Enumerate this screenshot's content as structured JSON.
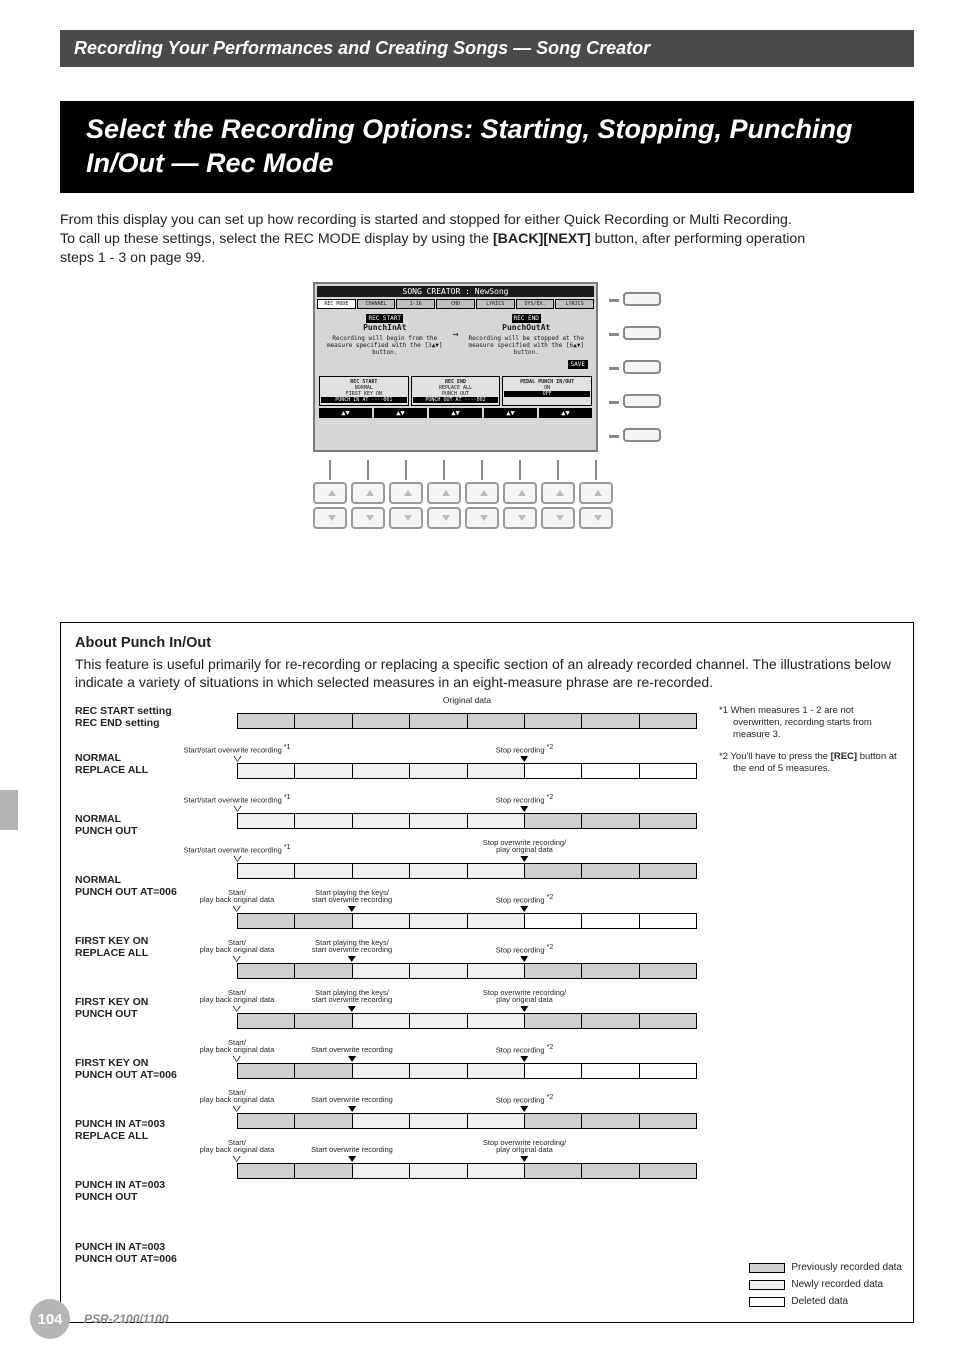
{
  "chapterHeader": "Recording Your Performances and Creating Songs — Song Creator",
  "sectionTitle": "Select the Recording Options: Starting, Stopping, Punching In/Out — Rec Mode",
  "intro": {
    "line1": "From this display you can set up how recording is started and stopped for either Quick Recording or Multi Recording.",
    "line2a": "To call up these settings, select the REC MODE display by using the ",
    "line2bold": "[BACK][NEXT]",
    "line2b": " button, after performing operation",
    "line3": "steps 1 - 3 on page 99."
  },
  "lcd": {
    "title": "SONG CREATOR : NewSong",
    "tabs": [
      "REC MODE",
      "CHANNEL",
      "1-16",
      "CHD",
      "LYRICS",
      "SYS/EX.",
      "LYRICS"
    ],
    "activeTab": 0,
    "recStartLabel": "REC START",
    "recStartValue": "PunchInAt",
    "recStartDesc": "Recording will begin from the measure specified with the [3▲▼] button.",
    "recEndLabel": "REC END",
    "recEndValue": "PunchOutAt",
    "recEndDesc": "Recording will be stopped at the measure specified with the [6▲▼] button.",
    "saveIcon": "SAVE",
    "bottomGroups": {
      "recStart": {
        "title": "REC START",
        "l1": "NORMAL",
        "l2": "FIRST KEY ON",
        "l3": "PUNCH IN AT ····001"
      },
      "recEnd": {
        "title": "REC END",
        "l1": "REPLACE ALL",
        "l2": "PUNCH OUT",
        "l3": "PUNCH OUT AT ····002"
      },
      "pedal": {
        "title": "PEDAL PUNCH IN/OUT",
        "l1": "ON",
        "l2": "OFF"
      }
    }
  },
  "aboutBox": {
    "title": "About Punch In/Out",
    "text": "This feature is useful primarily for re-recording or replacing a specific section of an already recorded channel. The illustrations below indicate a variety of situations in which selected measures in an eight-measure phrase are re-recorded."
  },
  "punchHeader1": "REC START setting",
  "punchHeader2": "REC END setting",
  "originalDataLabel": "Original data",
  "rows": [
    {
      "start": "NORMAL",
      "end": "REPLACE ALL",
      "a1": "Start/start overwrite recording *1",
      "a1x": 0,
      "a1t": "h",
      "a2": "Stop recording *2",
      "a2x": 62.5,
      "a2t": "s",
      "segs": [
        "new",
        "new",
        "new",
        "new",
        "new",
        "del",
        "del",
        "del"
      ]
    },
    {
      "start": "NORMAL",
      "end": "PUNCH OUT",
      "a1": "Start/start overwrite recording *1",
      "a1x": 0,
      "a1t": "h",
      "a2": "Stop recording *2",
      "a2x": 62.5,
      "a2t": "s",
      "segs": [
        "new",
        "new",
        "new",
        "new",
        "new",
        "prev",
        "prev",
        "prev"
      ]
    },
    {
      "start": "NORMAL",
      "end": "PUNCH OUT AT=006",
      "a1": "Start/start overwrite recording *1",
      "a1x": 0,
      "a1t": "h",
      "a2": "Stop overwrite recording/\nplay original data",
      "a2x": 62.5,
      "a2t": "s",
      "segs": [
        "new",
        "new",
        "new",
        "new",
        "new",
        "prev",
        "prev",
        "prev"
      ]
    },
    {
      "start": "FIRST KEY ON",
      "end": "REPLACE ALL",
      "a0": "Start/\nplay back original data",
      "a0x": 0,
      "a0t": "h",
      "a1": "Start playing the keys/\nstart overwrite recording",
      "a1x": 25,
      "a1t": "s",
      "a2": "Stop recording *2",
      "a2x": 62.5,
      "a2t": "s",
      "segs": [
        "prev",
        "prev",
        "new",
        "new",
        "new",
        "del",
        "del",
        "del"
      ]
    },
    {
      "start": "FIRST KEY ON",
      "end": "PUNCH OUT",
      "a0": "Start/\nplay back original data",
      "a0x": 0,
      "a0t": "h",
      "a1": "Start playing the keys/\nstart overwrite recording",
      "a1x": 25,
      "a1t": "s",
      "a2": "Stop recording *2",
      "a2x": 62.5,
      "a2t": "s",
      "segs": [
        "prev",
        "prev",
        "new",
        "new",
        "new",
        "prev",
        "prev",
        "prev"
      ]
    },
    {
      "start": "FIRST KEY ON",
      "end": "PUNCH OUT AT=006",
      "a0": "Start/\nplay back original data",
      "a0x": 0,
      "a0t": "h",
      "a1": "Start playing the keys/\nstart overwrite recording",
      "a1x": 25,
      "a1t": "s",
      "a2": "Stop overwrite recording/\nplay original data",
      "a2x": 62.5,
      "a2t": "s",
      "segs": [
        "prev",
        "prev",
        "new",
        "new",
        "new",
        "prev",
        "prev",
        "prev"
      ]
    },
    {
      "start": "PUNCH IN AT=003",
      "end": "REPLACE ALL",
      "a0": "Start/\nplay back original data",
      "a0x": 0,
      "a0t": "h",
      "a1": "Start overwrite recording",
      "a1x": 25,
      "a1t": "s",
      "a2": "Stop recording *2",
      "a2x": 62.5,
      "a2t": "s",
      "segs": [
        "prev",
        "prev",
        "new",
        "new",
        "new",
        "del",
        "del",
        "del"
      ]
    },
    {
      "start": "PUNCH IN AT=003",
      "end": "PUNCH OUT",
      "a0": "Start/\nplay back original data",
      "a0x": 0,
      "a0t": "h",
      "a1": "Start overwrite recording",
      "a1x": 25,
      "a1t": "s",
      "a2": "Stop recording *2",
      "a2x": 62.5,
      "a2t": "s",
      "segs": [
        "prev",
        "prev",
        "new",
        "new",
        "new",
        "prev",
        "prev",
        "prev"
      ]
    },
    {
      "start": "PUNCH IN AT=003",
      "end": "PUNCH OUT AT=006",
      "a0": "Start/\nplay back original data",
      "a0x": 0,
      "a0t": "h",
      "a1": "Start overwrite recording",
      "a1x": 25,
      "a1t": "s",
      "a2": "Stop overwrite recording/\nplay original data",
      "a2x": 62.5,
      "a2t": "s",
      "segs": [
        "prev",
        "prev",
        "new",
        "new",
        "new",
        "prev",
        "prev",
        "prev"
      ]
    }
  ],
  "footnotes": {
    "n1": "*1 When measures 1 - 2 are not overwritten, recording starts from measure 3.",
    "n2a": "*2 You'll have to press the ",
    "n2bold": "[REC]",
    "n2b": " button at the end of 5 measures."
  },
  "legend": {
    "prev": "Previously recorded data",
    "new": "Newly recorded data",
    "del": "Deleted data"
  },
  "pageNumber": "104",
  "model": "PSR-2100/1100"
}
